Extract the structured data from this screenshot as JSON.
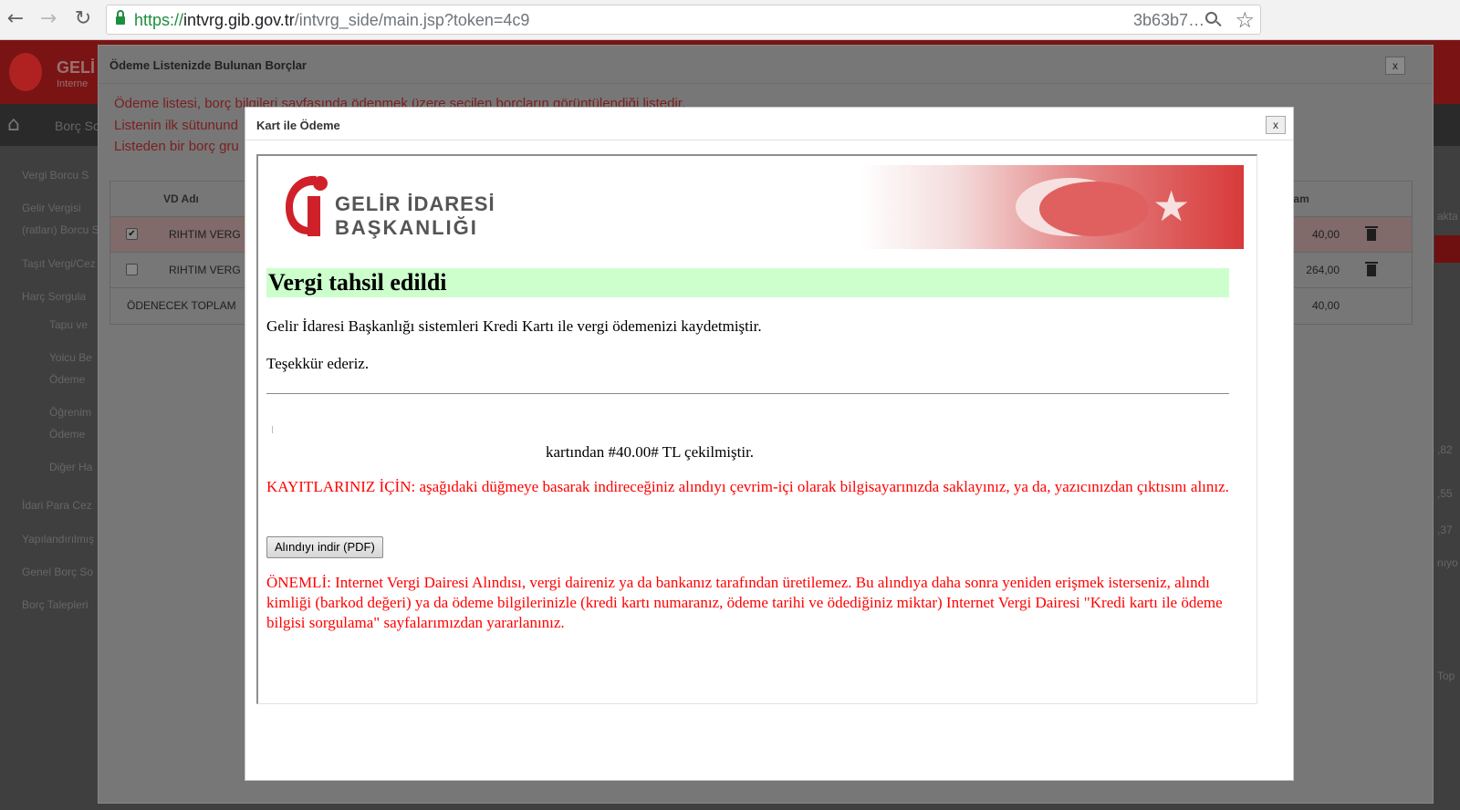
{
  "browser": {
    "url_scheme": "https://",
    "url_host": "intvrg.gib.gov.tr",
    "url_path": "/intvrg_side/main.jsp?token=4c9",
    "url_tail": "3b63b7…",
    "back_icon": "←",
    "forward_icon": "→",
    "reload_icon": "↻",
    "star_icon": "☆"
  },
  "background": {
    "logo_text": "GELİ",
    "logo_sub": "Interne",
    "nav_label": "Borç Sc",
    "sidebar": [
      "Vergi Borcu S",
      "Gelir Vergisi (ratları) Borcu S",
      "Taşıt Vergi/Cez",
      "Harç Sorgula",
      "Tapu ve",
      "Yolcu Be Ödeme",
      "Öğrenim Ödeme",
      "Diğer Ha",
      "İdari Para Cez",
      "Yapılandırılmış",
      "Genel Borç So",
      "Borç Talepleri"
    ],
    "right_edge": [
      "akta",
      ",82",
      ",55",
      ",37",
      "nıyo",
      "Top"
    ]
  },
  "outer_modal": {
    "title": "Ödeme Listenizde Bulunan Borçlar",
    "close": "x",
    "messages": [
      "Ödeme listesi, borç bilgileri sayfasında ödenmek üzere seçilen borçların görüntülendiği listedir.",
      "Listenin ilk sütunund",
      "Listeden bir borç gru"
    ],
    "table": {
      "col_vd": "VD Adı",
      "col_total": "Toplam",
      "rows": [
        {
          "checked": true,
          "check": "✔",
          "name": "RIHTIM VERG",
          "total": "40,00"
        },
        {
          "checked": false,
          "check": "",
          "name": "RIHTIM VERG",
          "total": "264,00"
        }
      ],
      "footer_label": "ÖDENECEK TOPLAM",
      "footer_total": "40,00"
    }
  },
  "inner_modal": {
    "title": "Kart ile Ödeme",
    "close": "x",
    "logo_line1": "GELİR İDARESİ",
    "logo_line2": "BAŞKANLIĞI",
    "status_title": "Vergi tahsil edildi",
    "line1": "Gelir İdaresi Başkanlığı sistemleri Kredi Kartı ile vergi ödemenizi kaydetmiştir.",
    "line2": "Teşekkür ederiz.",
    "amount_line": "kartından #40.00# TL çekilmiştir.",
    "records_note": "KAYITLARINIZ İÇİN: aşağıdaki düğmeye basarak indireceğiniz alındıyı çevrim-içi olarak bilgisayarınızda saklayınız, ya da, yazıcınızdan çıktısını alınız.",
    "pdf_button": "Alındıyı indir (PDF)",
    "important_note": "ÖNEMLİ: Internet Vergi Dairesi Alındısı, vergi daireniz ya da bankanız tarafından üretilemez. Bu alındıya daha sonra yeniden erişmek isterseniz, alındı kimliği (barkod değeri) ya da ödeme bilgilerinizle (kredi kartı numaranız, ödeme tarihi ve ödediğiniz miktar) Internet Vergi Dairesi \"Kredi kartı ile ödeme bilgisi sorgulama\" sayfalarımızdan yararlanınız."
  },
  "colors": {
    "status_bg": "#ccffcc",
    "warning_red": "#ff0000",
    "brand_red": "#d0202a",
    "secure_green": "#1e8e3e"
  }
}
